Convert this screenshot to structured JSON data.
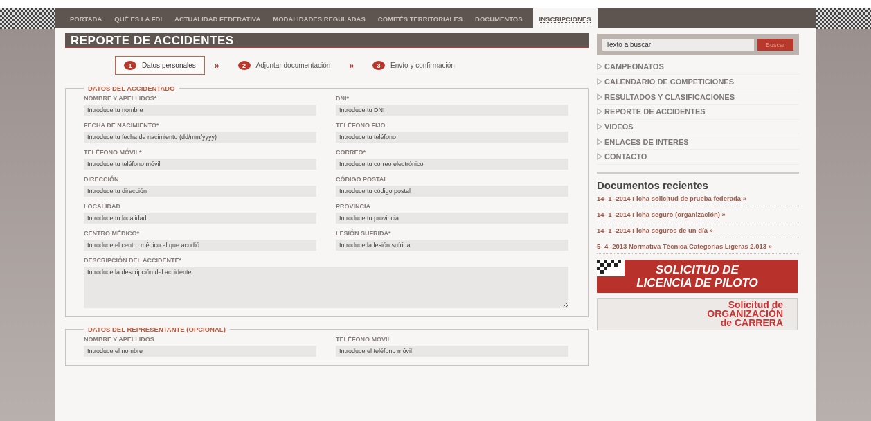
{
  "nav": [
    {
      "label": "PORTADA",
      "selected": false
    },
    {
      "label": "QUÉ ES LA FDI",
      "selected": false
    },
    {
      "label": "ACTUALIDAD FEDERATIVA",
      "selected": false
    },
    {
      "label": "MODALIDADES REGULADAS",
      "selected": false
    },
    {
      "label": "COMITÉS TERRITORIALES",
      "selected": false
    },
    {
      "label": "DOCUMENTOS",
      "selected": false
    },
    {
      "label": "INSCRIPCIONES",
      "selected": true
    }
  ],
  "page_title": "REPORTE DE ACCIDENTES",
  "steps": [
    {
      "number": "1",
      "label": "Datos personales",
      "selected": true
    },
    {
      "number": "2",
      "label": "Adjuntar documentación",
      "selected": false
    },
    {
      "number": "3",
      "label": "Envío y confirmación",
      "selected": false
    }
  ],
  "step_separator": "»",
  "sections": [
    {
      "legend": "DATOS DEL ACCIDENTADO",
      "fields": [
        {
          "label": "NOMBRE Y APELLIDOS*",
          "placeholder": "Introduce tu nombre",
          "kind": "input"
        },
        {
          "label": "DNI*",
          "placeholder": "Introduce tu DNI",
          "kind": "input"
        },
        {
          "label": "FECHA DE NACIMIENTO*",
          "placeholder": "Introduce tu fecha de nacimiento (dd/mm/yyyy)",
          "kind": "input"
        },
        {
          "label": "TELÉFONO FIJO",
          "placeholder": "Introduce tu teléfono",
          "kind": "input"
        },
        {
          "label": "TELÉFONO MÓVIL*",
          "placeholder": "Introduce tu teléfono móvil",
          "kind": "input"
        },
        {
          "label": "CORREO*",
          "placeholder": "Introduce tu correo electrónico",
          "kind": "input"
        },
        {
          "label": "DIRECCIÓN",
          "placeholder": "Introduce tu dirección",
          "kind": "input"
        },
        {
          "label": "CÓDIGO POSTAL",
          "placeholder": "Introduce tu código postal",
          "kind": "input"
        },
        {
          "label": "LOCALIDAD",
          "placeholder": "Introduce tu localidad",
          "kind": "input"
        },
        {
          "label": "PROVINCIA",
          "placeholder": "Introduce tu provincia",
          "kind": "input"
        },
        {
          "label": "CENTRO MÉDICO*",
          "placeholder": "Introduce el centro médico al que acudió",
          "kind": "input"
        },
        {
          "label": "LESIÓN SUFRIDA*",
          "placeholder": "Introduce la lesión sufrida",
          "kind": "input"
        },
        {
          "label": "DESCRIPCIÓN DEL ACCIDENTE*",
          "placeholder": "Introduce la descripción del accidente",
          "kind": "textarea"
        }
      ]
    },
    {
      "legend": "DATOS DEL REPRESENTANTE (OPCIONAL)",
      "fields": [
        {
          "label": "NOMBRE Y APELLIDOS",
          "placeholder": "Introduce el nombre",
          "kind": "input"
        },
        {
          "label": "TELÉFONO MOVIL",
          "placeholder": "Introduce el teléfono móvil",
          "kind": "input"
        }
      ]
    }
  ],
  "search": {
    "value": "Texto a buscar",
    "button": "Buscar"
  },
  "sidebar_menu": [
    "CAMPEONATOS",
    "CALENDARIO DE COMPETICIONES",
    "RESULTADOS Y CLASIFICACIONES",
    "REPORTE DE ACCIDENTES",
    "VIDEOS",
    "ENLACES DE INTERÉS",
    "CONTACTO"
  ],
  "recent_documents": {
    "title": "Documentos recientes",
    "items": [
      "14- 1 -2014 Ficha solicitud de prueba federada »",
      "14- 1 -2014 Ficha seguro (organización) »",
      "14- 1 -2014 Ficha seguros de un día »",
      "5- 4 -2013 Normativa Técnica Categorías Ligeras 2.013 »"
    ]
  },
  "banners": [
    {
      "kind": "pilot",
      "lines": [
        "SOLICITUD DE",
        "LICENCIA DE PILOTO"
      ]
    },
    {
      "kind": "race",
      "lines": [
        "Solicitud de",
        "ORGANIZACIÓN",
        "de CARRERA"
      ]
    }
  ]
}
